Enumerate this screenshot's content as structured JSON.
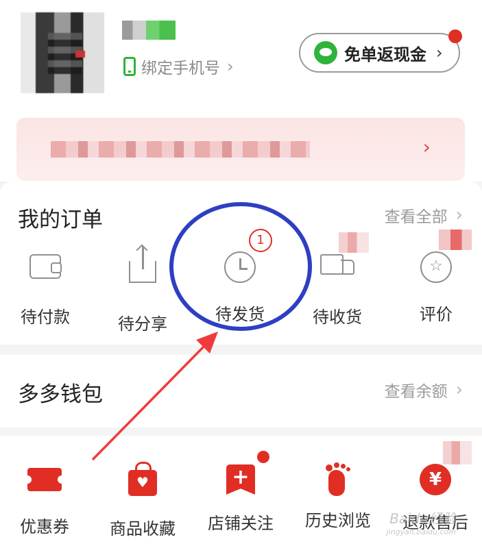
{
  "profile": {
    "bind_phone_label": "绑定手机号",
    "bind_phone_chevron": "›",
    "cashback_label": "免单返现金",
    "cashback_chevron": "›",
    "banner_chevron": "›"
  },
  "orders": {
    "title": "我的订单",
    "view_all_label": "查看全部",
    "chevron": "›",
    "items": [
      {
        "label": "待付款",
        "icon": "wallet-icon"
      },
      {
        "label": "待分享",
        "icon": "share-icon"
      },
      {
        "label": "待发货",
        "icon": "clock-icon",
        "badge": "1"
      },
      {
        "label": "待收货",
        "icon": "truck-icon"
      },
      {
        "label": "评价",
        "icon": "review-star-icon"
      }
    ]
  },
  "wallet": {
    "title": "多多钱包",
    "view_balance_label": "查看余额",
    "chevron": "›"
  },
  "services": {
    "items": [
      {
        "label": "优惠券",
        "icon": "coupon-icon"
      },
      {
        "label": "商品收藏",
        "icon": "favorites-bag-icon"
      },
      {
        "label": "店铺关注",
        "icon": "followed-shop-icon"
      },
      {
        "label": "历史浏览",
        "icon": "footprint-icon"
      },
      {
        "label": "退款售后",
        "icon": "refund-yen-icon"
      }
    ]
  },
  "colors": {
    "brand_red": "#e02e24",
    "wechat_green": "#2fb33a",
    "annotation_blue": "#2e3fc2",
    "annotation_red": "#ef3b3b"
  },
  "watermark": {
    "text": "Baidu经验",
    "subtext": "jingyan.baidu.com"
  }
}
